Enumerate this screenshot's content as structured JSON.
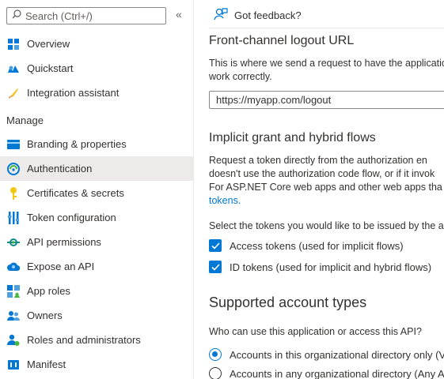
{
  "search": {
    "placeholder": "Search (Ctrl+/)"
  },
  "sidebar": {
    "collapse_glyph": "«",
    "items_top": [
      {
        "label": "Overview",
        "icon": "overview-icon"
      },
      {
        "label": "Quickstart",
        "icon": "quickstart-icon"
      },
      {
        "label": "Integration assistant",
        "icon": "integration-assistant-icon"
      }
    ],
    "section_label": "Manage",
    "items_manage": [
      {
        "label": "Branding & properties",
        "icon": "branding-icon"
      },
      {
        "label": "Authentication",
        "icon": "authentication-icon",
        "active": true
      },
      {
        "label": "Certificates & secrets",
        "icon": "key-icon"
      },
      {
        "label": "Token configuration",
        "icon": "token-config-icon"
      },
      {
        "label": "API permissions",
        "icon": "api-permissions-icon"
      },
      {
        "label": "Expose an API",
        "icon": "cloud-icon"
      },
      {
        "label": "App roles",
        "icon": "app-roles-icon"
      },
      {
        "label": "Owners",
        "icon": "owners-icon"
      },
      {
        "label": "Roles and administrators",
        "icon": "roles-icon"
      },
      {
        "label": "Manifest",
        "icon": "manifest-icon"
      }
    ]
  },
  "main": {
    "feedback_label": "Got feedback?",
    "logout": {
      "title": "Front-channel logout URL",
      "desc_line1": "This is where we send a request to have the applicatio",
      "desc_line2": "work correctly.",
      "url_value": "https://myapp.com/logout"
    },
    "implicit": {
      "title": "Implicit grant and hybrid flows",
      "desc_line1": "Request a token directly from the authorization en",
      "desc_line2": "doesn't use the authorization code flow, or if it invok",
      "desc_line3": "For ASP.NET Core web apps and other web apps tha",
      "desc_link": "tokens.",
      "select_prompt": "Select the tokens you would like to be issued by the a",
      "access_tokens_label": "Access tokens (used for implicit flows)",
      "access_tokens_checked": true,
      "id_tokens_label": "ID tokens (used for implicit and hybrid flows)",
      "id_tokens_checked": true
    },
    "account_types": {
      "title": "Supported account types",
      "question": "Who can use this application or access this API?",
      "option1": "Accounts in this organizational directory only (Ve",
      "option1_selected": true,
      "option2": "Accounts in any organizational directory (Any Az",
      "option2_selected": false
    }
  },
  "colors": {
    "accent": "#0078d4",
    "active_bg": "#edebe9",
    "text": "#323130"
  }
}
